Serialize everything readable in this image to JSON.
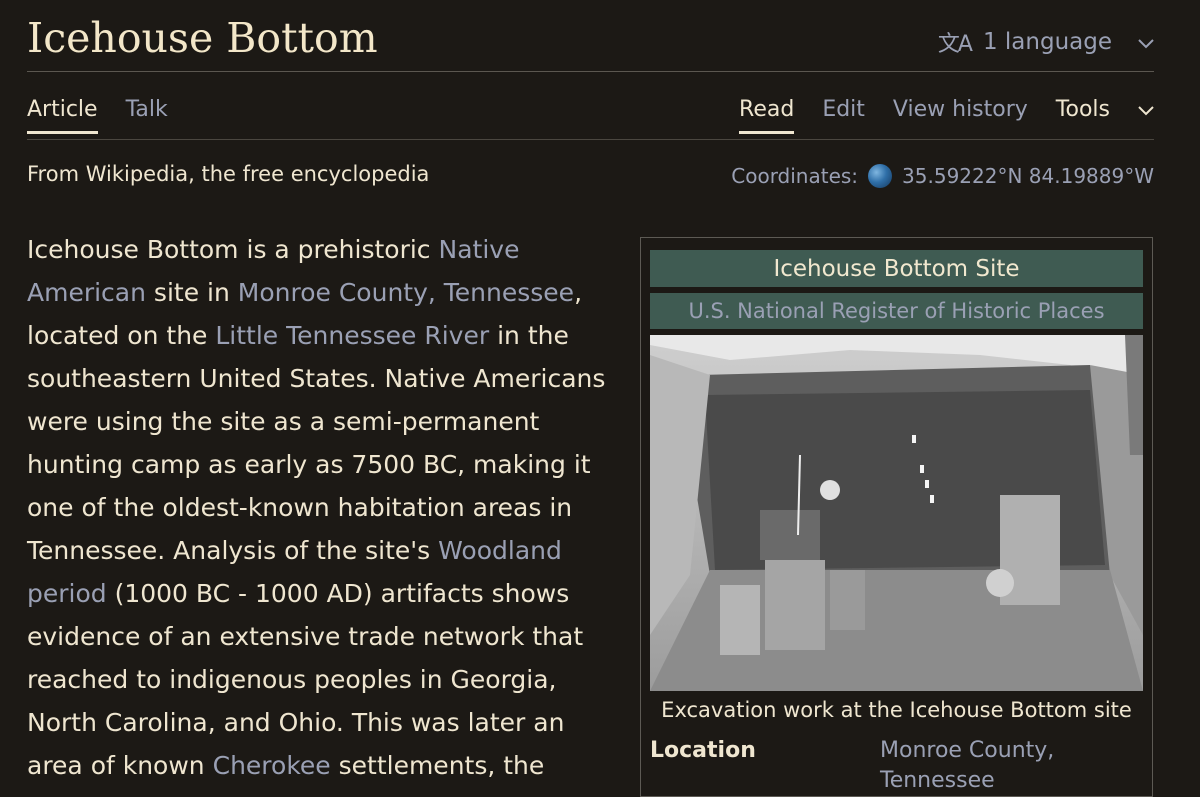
{
  "page": {
    "title": "Icehouse Bottom",
    "languages_label": "1 language",
    "tabs_left": [
      "Article",
      "Talk"
    ],
    "tabs_right": [
      "Read",
      "Edit",
      "View history",
      "Tools"
    ],
    "from_text": "From Wikipedia, the free encyclopedia",
    "coords_label": "Coordinates:",
    "coords_value": "35.59222°N 84.19889°W"
  },
  "article": {
    "segments": [
      {
        "t": "Icehouse Bottom",
        "b": true
      },
      {
        "t": " is a prehistoric "
      },
      {
        "t": "Native American",
        "link": true
      },
      {
        "t": " site in "
      },
      {
        "t": "Monroe County, Tennessee",
        "link": true
      },
      {
        "t": ", located on the "
      },
      {
        "t": "Little Tennessee River",
        "link": true
      },
      {
        "t": " in the southeastern United States. Native Americans were using the site as a semi-permanent hunting camp as early as 7500 BC, making it one of the oldest-known habitation areas in Tennessee. Analysis of the site's "
      },
      {
        "t": "Woodland period",
        "link": true
      },
      {
        "t": " (1000 BC - 1000 AD) artifacts shows evidence of an extensive trade network that reached to indigenous peoples in Georgia, North Carolina, and Ohio. This was later an area of known "
      },
      {
        "t": "Cherokee",
        "link": true
      },
      {
        "t": " settlements, the"
      }
    ]
  },
  "infobox": {
    "title": "Icehouse Bottom Site",
    "subtitle": "U.S. National Register of Historic Places",
    "caption": "Excavation work at the Icehouse Bottom site",
    "rows": [
      {
        "label": "Location",
        "value": "Monroe County, Tennessee"
      }
    ]
  },
  "icons": {
    "translate": "translate-icon",
    "chevron": "chevron-down-icon",
    "globe": "globe-icon"
  }
}
